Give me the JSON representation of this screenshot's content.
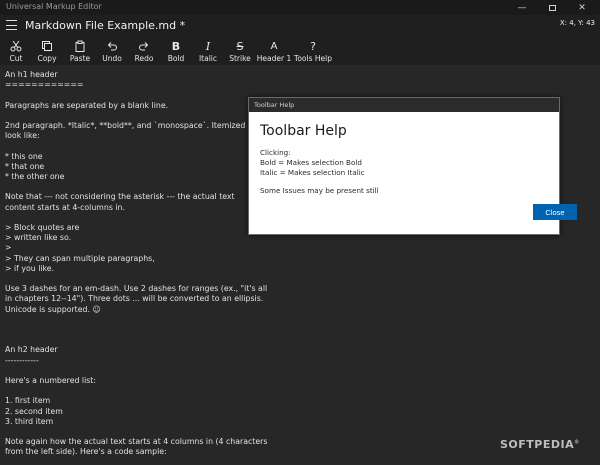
{
  "window": {
    "app_title": "Universal Markup Editor",
    "minimize_glyph": "—",
    "close_glyph": "✕"
  },
  "header": {
    "doc_title": "Markdown File Example.md *",
    "cursor_pos": "X: 4, Y: 43"
  },
  "toolbar": {
    "items": [
      {
        "label": "Cut",
        "icon": "scissors-icon"
      },
      {
        "label": "Copy",
        "icon": "copy-icon"
      },
      {
        "label": "Paste",
        "icon": "paste-icon"
      },
      {
        "label": "Undo",
        "icon": "undo-icon"
      },
      {
        "label": "Redo",
        "icon": "redo-icon"
      },
      {
        "label": "Bold",
        "icon": "bold-icon",
        "glyph": "B"
      },
      {
        "label": "Italic",
        "icon": "italic-icon",
        "glyph": "I"
      },
      {
        "label": "Strike",
        "icon": "strike-icon",
        "glyph": "S"
      },
      {
        "label": "Header 1",
        "icon": "header-icon",
        "glyph": "A"
      },
      {
        "label": "Tools Help",
        "icon": "help-icon",
        "glyph": "?"
      }
    ]
  },
  "editor": {
    "lines": [
      "An h1 header",
      "============",
      "",
      "Paragraphs are separated by a blank line.",
      "",
      "2nd paragraph. *Italic*, **bold**, and `monospace`. Itemized lists",
      "look like:",
      "",
      "  * this one",
      "  * that one",
      "  * the other one",
      "",
      "Note that --- not considering the asterisk --- the actual text",
      "content starts at 4-columns in.",
      "",
      "> Block quotes are",
      "> written like so.",
      ">",
      "> They can span multiple paragraphs,",
      "> if you like.",
      "",
      "Use 3 dashes for an em-dash. Use 2 dashes for ranges (ex., \"it's all",
      "in chapters 12--14\"). Three dots ... will be converted to an ellipsis.",
      "Unicode is supported. ☺",
      "",
      "",
      "",
      "An h2 header",
      "------------",
      "",
      "Here's a numbered list:",
      "",
      " 1. first item",
      " 2. second item",
      " 3. third item",
      "",
      "Note again how the actual text starts at 4 columns in (4 characters",
      "from the left side). Here's a code sample:",
      ""
    ]
  },
  "dialog": {
    "bar_title": "Toolbar Help",
    "heading": "Toolbar Help",
    "lines": [
      "Clicking:",
      "Bold = Makes selection Bold",
      "Italic = Makes selection Italic",
      "",
      "Some Issues may be present still"
    ],
    "close_label": "Close",
    "accent": "#0063b1"
  },
  "watermark": {
    "text": "SOFTPEDIA",
    "mark": "®"
  }
}
